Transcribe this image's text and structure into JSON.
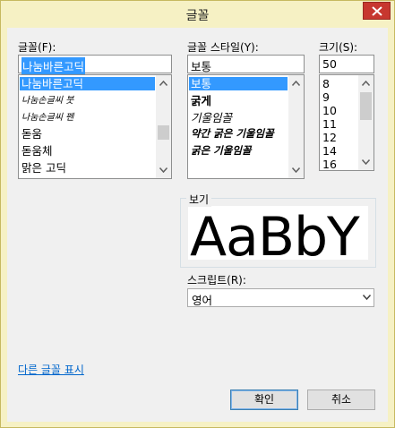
{
  "window": {
    "title": "글꼴"
  },
  "font": {
    "label": "글꼴(F):",
    "value": "나눔바른고딕",
    "items": [
      "나눔바른고딕",
      "나눔손글씨 붓",
      "나눔손글씨 펜",
      "돋움",
      "돋움체",
      "맑은 고딕"
    ]
  },
  "style": {
    "label": "글꼴 스타일(Y):",
    "value": "보통",
    "items": [
      "보통",
      "굵게",
      "기울임꼴",
      "약간 굵은 기울임꼴",
      "굵은 기울임꼴"
    ]
  },
  "size": {
    "label": "크기(S):",
    "value": "50",
    "items": [
      "8",
      "9",
      "10",
      "11",
      "12",
      "14",
      "16"
    ]
  },
  "preview": {
    "label": "보기",
    "sample": "AaBbY"
  },
  "script": {
    "label": "스크립트(R):",
    "value": "영어"
  },
  "more_fonts_link": "다른 글꼴 표시",
  "buttons": {
    "ok": "확인",
    "cancel": "취소"
  }
}
